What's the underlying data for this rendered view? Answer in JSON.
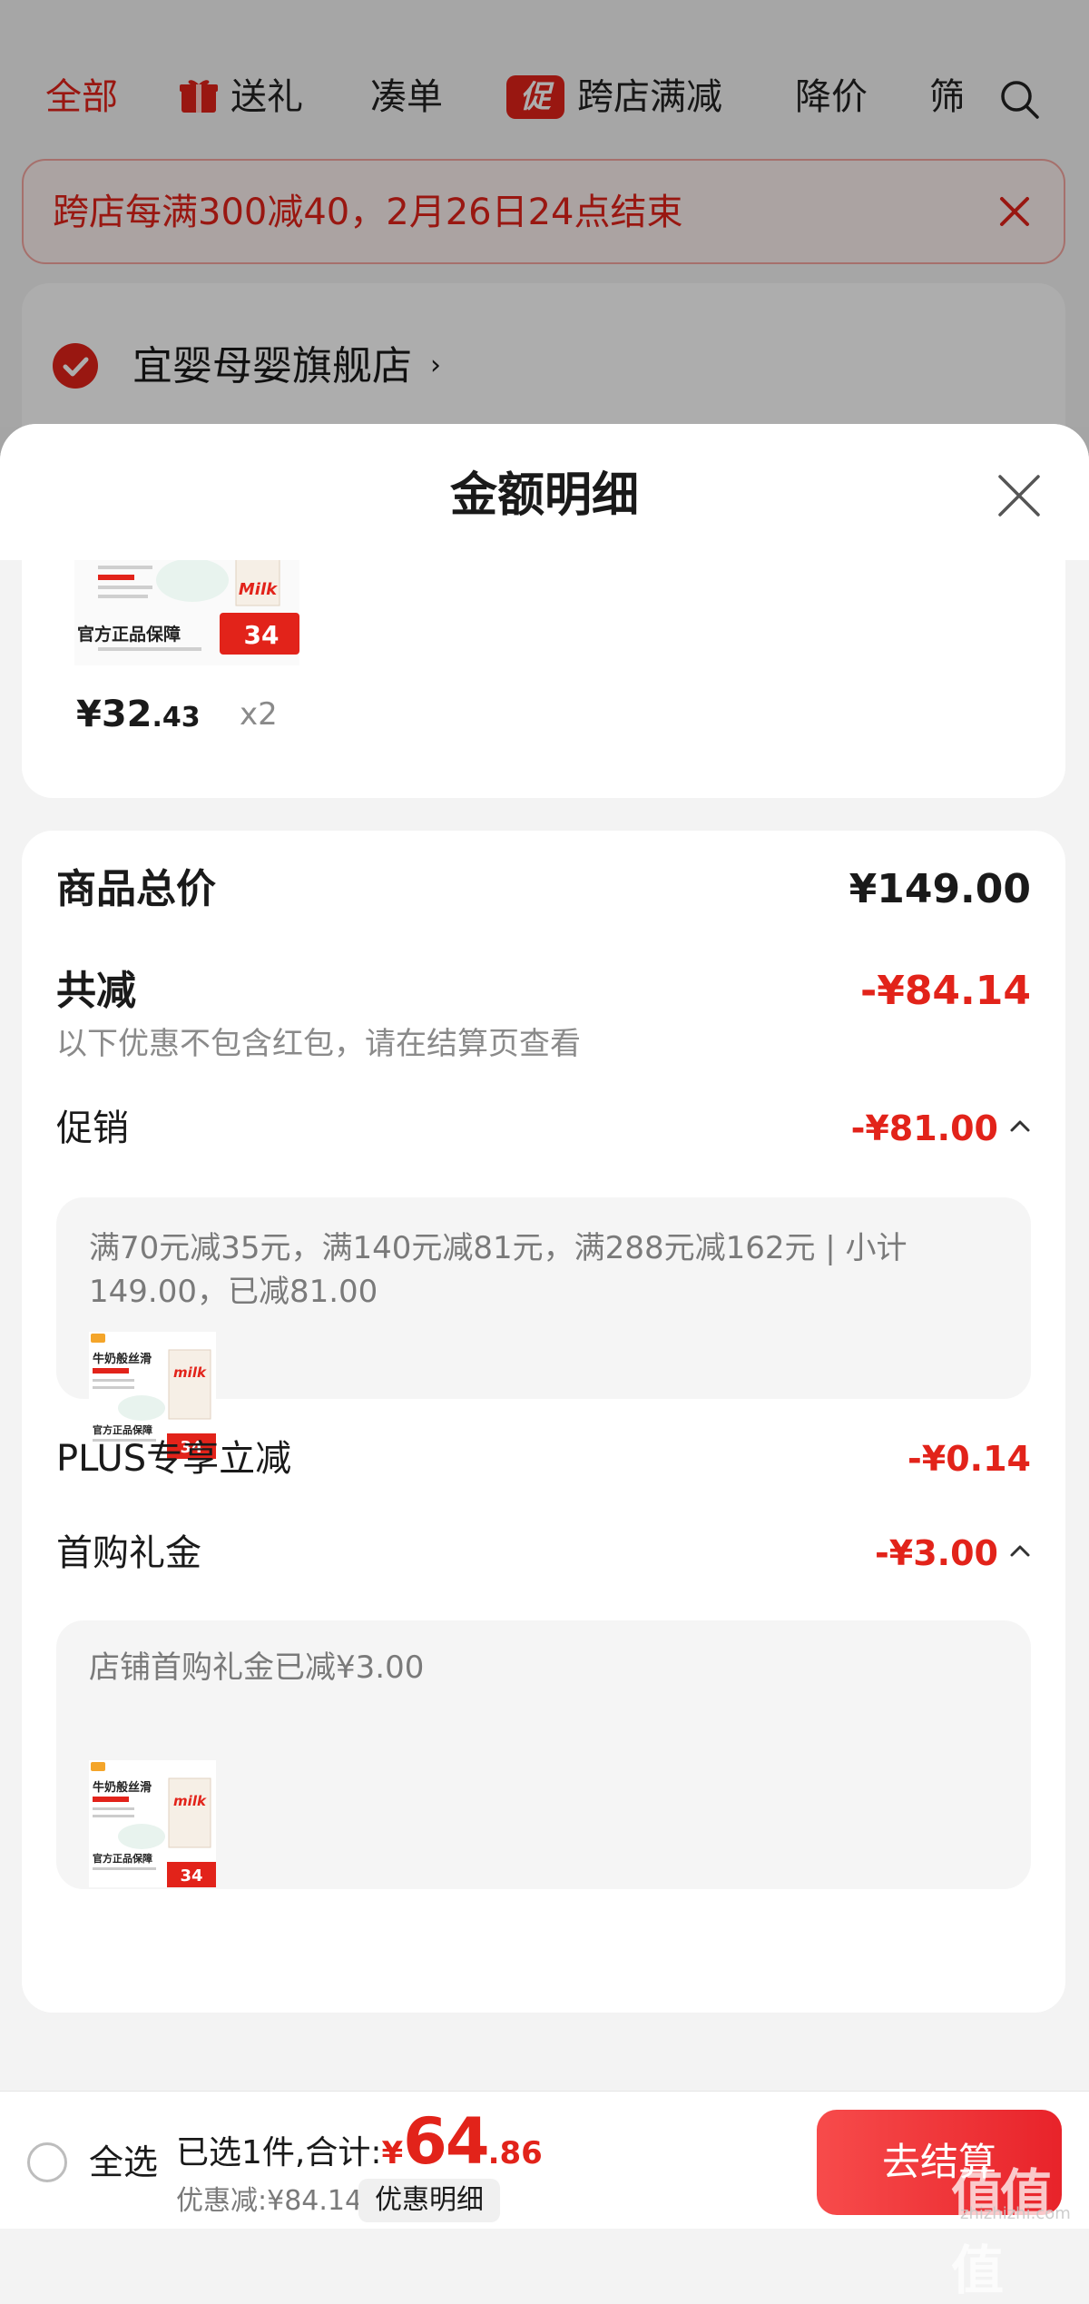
{
  "background": {
    "tabs": [
      {
        "label": "全部",
        "active": true
      },
      {
        "label": "送礼",
        "icon": "gift-icon"
      },
      {
        "label": "凑单"
      },
      {
        "label": "跨店满减",
        "icon": "promo-badge-icon",
        "badge": "促"
      },
      {
        "label": "降价"
      },
      {
        "label": "筛"
      }
    ],
    "promo_banner": "跨店每满300减40，2月26日24点结束",
    "store_name": "宜婴母婴旗舰店",
    "store_chevron": "›"
  },
  "sheet": {
    "title": "金额明细",
    "product": {
      "price_int": "¥32",
      "price_dec": ".43",
      "qty": "x2",
      "thumb": {
        "tag": "官方正品保障",
        "price_badge": "34",
        "brand_text": "Milk"
      }
    },
    "total": {
      "label": "商品总价",
      "value": "¥149.00"
    },
    "reduce": {
      "label": "共减",
      "value": "-¥84.14",
      "note": "以下优惠不包含红包，请在结算页查看"
    },
    "promo": {
      "label": "促销",
      "value": "-¥81.00",
      "detail": "满70元减35元，满140元减81元，满288元减162元 | 小计149.00，已减81.00"
    },
    "plus": {
      "label": "PLUS专享立减",
      "value": "-¥0.14"
    },
    "first_gift": {
      "label": "首购礼金",
      "value": "-¥3.00",
      "detail": "店铺首购礼金已减¥3.00"
    },
    "thumb_small": {
      "title": "牛奶般丝滑",
      "tag": "官方正品保障",
      "price_badge": "34",
      "brand_text": "milk"
    }
  },
  "bottom_bar": {
    "select_all": "全选",
    "summary_prefix": "已选1件,合计:",
    "currency": "¥",
    "total_int": "64",
    "total_dec": ".86",
    "saved": "优惠减:¥84.14",
    "detail_button": "优惠明细",
    "checkout_button": "去结算"
  },
  "watermark": {
    "text": "值值值",
    "url": "zhizhizhi.com"
  },
  "colors": {
    "accent": "#e2231a",
    "checkout_gradient_start": "#f74b4b"
  }
}
